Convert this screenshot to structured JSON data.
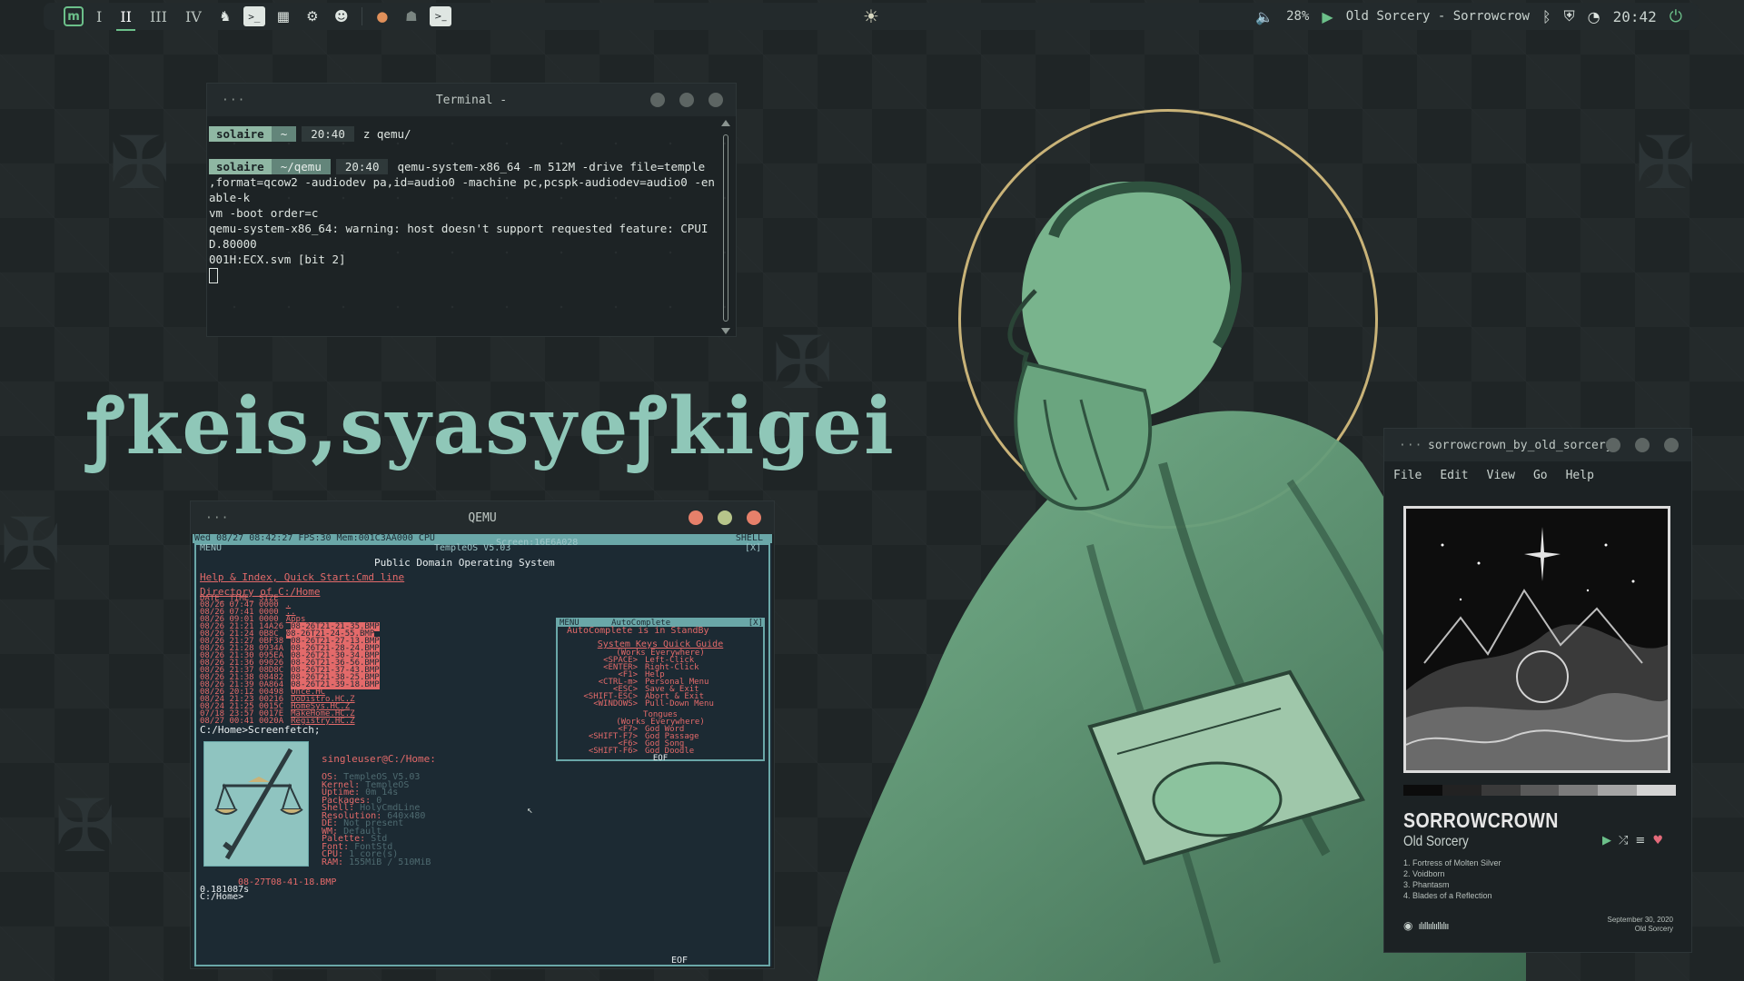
{
  "topbar": {
    "workspaces": [
      "I",
      "II",
      "III",
      "IV"
    ],
    "active_workspace": "II",
    "volume": "28%",
    "now_playing": "Old Sorcery - Sorrowcrow",
    "clock": "20:42",
    "center_icon": "☀"
  },
  "terminal": {
    "title": "Terminal -",
    "menu_dots": "···",
    "prompt1": {
      "user": "solaire",
      "dir": "~",
      "time": "20:40",
      "cmd": "z qemu/"
    },
    "prompt2": {
      "user": "solaire",
      "dir": "~/qemu",
      "time": "20:40",
      "cmd": "qemu-system-x86_64 -m 512M -drive file=temple"
    },
    "output": ",format=qcow2 -audiodev pa,id=audio0 -machine pc,pcspk-audiodev=audio0 -enable-k\nvm -boot order=c\nqemu-system-x86_64: warning: host doesn't support requested feature: CPUID.80000\n001H:ECX.svm [bit 2]"
  },
  "big_title": "ꝭkeis,syasyeꝭkigei",
  "qemu": {
    "title": "QEMU",
    "menu_dots": "···",
    "status_bar": "Wed 08/27 08:42:27 FPS:30 Mem:001C3AA000 CPU",
    "status_right": "SHELL",
    "menu": "MENU",
    "temple_title": "TempleOS V5.03",
    "screen_caption": "Screen:16E6A028",
    "close": "[X]",
    "subtitle": "Public Domain Operating System",
    "help_links": "Help & Index, Quick Start:Cmd line",
    "dir_header": "Directory of C:/Home",
    "dir_cols": "DATE_ TIME_ SIZE",
    "dir_rows": [
      [
        "08/26 07:47 0000",
        "."
      ],
      [
        "08/26 07:41 0000",
        ".."
      ],
      [
        "08/26 09:01 0000",
        "Apps"
      ],
      [
        "08/26 21:21 14A26",
        "08-26T21-21-35.BMP"
      ],
      [
        "08/26 21:24 0B8C",
        "08-26T21-24-55.BMP"
      ],
      [
        "08/26 21:27 0BF38",
        "08-26T21-27-13.BMP"
      ],
      [
        "08/26 21:28 0934A",
        "08-26T21-28-24.BMP"
      ],
      [
        "08/26 21:30 095EA",
        "08-26T21-30-34.BMP"
      ],
      [
        "08/26 21:36 09026",
        "08-26T21-36-56.BMP"
      ],
      [
        "08/26 21:37 08D8C",
        "08-26T21-37-43.BMP"
      ],
      [
        "08/26 21:38 08482",
        "08-26T21-38-25.BMP"
      ],
      [
        "08/26 21:39 0A864",
        "08-26T21-39-18.BMP"
      ],
      [
        "08/26 20:12 00498",
        "Once.HC"
      ],
      [
        "08/24 21:23 00216",
        "DoDistro.HC.Z"
      ],
      [
        "08/24 21:25 0015C",
        "HomeSys.HC.Z"
      ],
      [
        "07/18 23:57 0017E",
        "MakeHome.HC.Z"
      ],
      [
        "08/27 00:41 0020A",
        "Registry.HC.Z"
      ]
    ],
    "prompt": "C:/Home>Screenfetch;",
    "fetch_user": "singleuser@C:/Home:",
    "fetch_lines": [
      [
        "OS:",
        "TempleOS V5.03"
      ],
      [
        "Kernel:",
        "TempleOS"
      ],
      [
        "Uptime:",
        "0m 14s"
      ],
      [
        "Packages:",
        "0"
      ],
      [
        "Shell:",
        "HolyCmdLine"
      ],
      [
        "Resolution:",
        "640x480"
      ],
      [
        "DE:",
        "Not present"
      ],
      [
        "WM:",
        "Default"
      ],
      [
        "Palette:",
        "Std"
      ],
      [
        "Font:",
        "FontStd"
      ],
      [
        "CPU:",
        "1 core(s)"
      ],
      [
        "RAM:",
        "155MiB / 510MiB"
      ]
    ],
    "saved": "08-27T08-41-18.BMP",
    "elapsed": "0.181087s",
    "final_prompt": "C:/Home>",
    "eof": "EOF",
    "autocomplete": {
      "menu": "MENU",
      "title": "AutoComplete",
      "close": "[X]",
      "standby": "AutoComplete is in StandBy",
      "keys_title": "System Keys Quick Guide",
      "everywhere": "(Works Everywhere)",
      "keys": [
        [
          "<SPACE>",
          "Left-Click"
        ],
        [
          "<ENTER>",
          "Right-Click"
        ],
        [
          "<F1>",
          "Help"
        ],
        [
          "<CTRL-m>",
          "Personal Menu"
        ],
        [
          "<ESC>",
          "Save & Exit"
        ],
        [
          "<SHIFT-ESC>",
          "Abort & Exit"
        ],
        [
          "<WINDOWS>",
          "Pull-Down Menu"
        ]
      ],
      "tongues_title": "Tongues",
      "tongues_everywhere": "(Works Everywhere)",
      "tongues": [
        [
          "<F7>",
          "God Word"
        ],
        [
          "<SHIFT-F7>",
          "God Passage"
        ],
        [
          "<F6>",
          "God Song"
        ],
        [
          "<SHIFT-F6>",
          "God Doodle"
        ]
      ],
      "eof": "EOF"
    }
  },
  "player": {
    "title": "sorrowcrown_by_old_sorcery",
    "menu_dots": "···",
    "menu": [
      "File",
      "Edit",
      "View",
      "Go",
      "Help"
    ],
    "album": "SORROWCROWN",
    "artist": "Old Sorcery",
    "tracks": [
      "1. Fortress of Molten Silver",
      "2. Voidborn",
      "3. Phantasm",
      "4. Blades of a Reflection"
    ],
    "date": "September 30, 2020",
    "label": "Old Sorcery",
    "palette": [
      "#0c0c0c",
      "#222222",
      "#3a3a3a",
      "#5a5a5a",
      "#7c7c7c",
      "#a5a5a5",
      "#d4d4d4"
    ]
  },
  "colors": {
    "accent": "#6cc08a",
    "halo": "#c9b378",
    "figure": "#6aa57f",
    "title": "#8fc7b8"
  }
}
